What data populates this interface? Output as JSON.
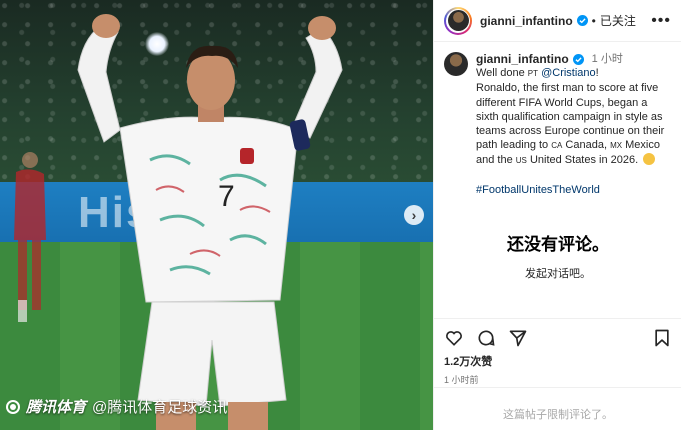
{
  "media": {
    "ad_text": "Hisense",
    "watermark": {
      "brand": "腾讯体育",
      "handle": "@腾讯体育足球资讯"
    }
  },
  "post": {
    "header": {
      "username": "gianni_infantino",
      "separator": "•",
      "follow_status": "已关注",
      "more_icon": "more-horizontal-icon"
    },
    "caption": {
      "username": "gianni_infantino",
      "time": "1 小时",
      "line1_prefix": "Well done ",
      "flag_pt": "PT",
      "mention": "@Cristiano",
      "line1_suffix": "!",
      "body_part1": "Ronaldo, the first man to score at five different FIFA World Cups, began a sixth qualification campaign in style as teams across Europe continue on their path leading to ",
      "flag_ca": "CA",
      "body_part2": " Canada, ",
      "flag_mx": "MX",
      "body_part3": " Mexico and the ",
      "flag_us": "US",
      "body_part4": " United States in 2026. ",
      "hashtag": "#FootballUnitesTheWorld"
    },
    "comments": {
      "empty_title": "还没有评论。",
      "empty_subtitle": "发起对话吧。",
      "limited_notice": "这篇帖子限制评论了。"
    },
    "actions": {
      "like_icon": "heart-icon",
      "comment_icon": "comment-icon",
      "share_icon": "send-icon",
      "save_icon": "bookmark-icon",
      "likes": "1.2万次赞",
      "time": "1 小时前"
    }
  },
  "colors": {
    "link": "#00376b",
    "verified": "#0095f6",
    "muted": "#737373"
  }
}
